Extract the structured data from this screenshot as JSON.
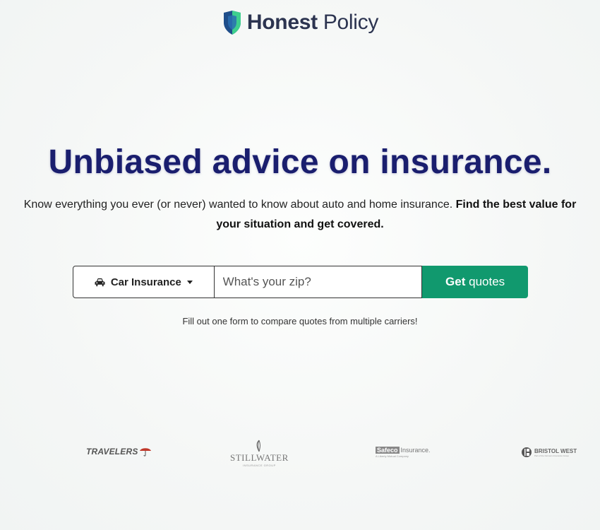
{
  "brand": {
    "name_bold": "Honest",
    "name_regular": " Policy",
    "logo_icon": "shield-icon",
    "colors": {
      "dark": "#1a3a7a",
      "light": "#3ecf8e",
      "text": "#2c3450"
    }
  },
  "hero": {
    "title": "Unbiased advice on insurance.",
    "subtitle_regular": "Know everything you ever (or never) wanted to know about auto and home insurance. ",
    "subtitle_bold": "Find the best value for your situation and get covered.",
    "title_color": "#1a1e6e"
  },
  "quote_form": {
    "insurance_type": "Car Insurance",
    "insurance_icon": "car-icon",
    "zip_placeholder": "What's your zip?",
    "zip_value": "",
    "button_bold": "Get",
    "button_regular": " quotes",
    "button_color": "#11996e",
    "note": "Fill out one form to compare quotes from multiple carriers!"
  },
  "carriers": [
    {
      "name": "TRAVELERS",
      "icon": "umbrella-icon"
    },
    {
      "name": "STILLWATER",
      "subtitle": "INSURANCE GROUP"
    },
    {
      "name": "Safeco",
      "suffix": "Insurance.",
      "subtitle": "A Liberty Mutual Company"
    },
    {
      "name": "BRISTOL WEST",
      "subtitle": "Part of the Farmers Insurance Group"
    }
  ]
}
